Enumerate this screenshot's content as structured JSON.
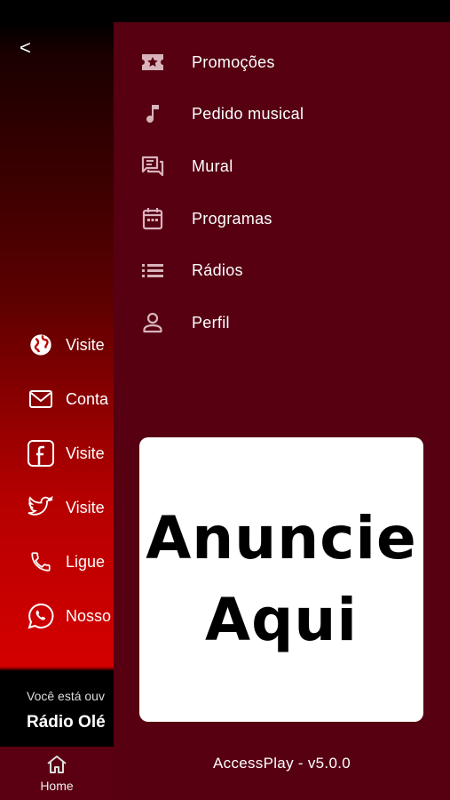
{
  "background": {
    "back_label": "<",
    "items": [
      {
        "icon": "globe-icon",
        "label": "Visite"
      },
      {
        "icon": "mail-icon",
        "label": "Conta"
      },
      {
        "icon": "facebook-icon",
        "label": "Visite"
      },
      {
        "icon": "twitter-icon",
        "label": "Visite"
      },
      {
        "icon": "phone-icon",
        "label": "Ligue"
      },
      {
        "icon": "whatsapp-icon",
        "label": "Nosso"
      }
    ],
    "now_playing": {
      "caption": "Você está ouv",
      "station": "Rádio Olé"
    },
    "tab_home": "Home"
  },
  "drawer": {
    "menu": [
      {
        "icon": "ticket-star-icon",
        "label": "Promoções"
      },
      {
        "icon": "music-note-icon",
        "label": "Pedido musical"
      },
      {
        "icon": "forum-icon",
        "label": "Mural"
      },
      {
        "icon": "calendar-icon",
        "label": "Programas"
      },
      {
        "icon": "list-icon",
        "label": "Rádios"
      },
      {
        "icon": "person-icon",
        "label": "Perfil"
      }
    ],
    "ad": {
      "line1": "Anuncie",
      "line2": "Aqui"
    },
    "version": "AccessPlay - v5.0.0"
  },
  "colors": {
    "drawer_bg": "#560012",
    "icon_tint": "#d9b3bb",
    "bottom_bar": "#5a0012"
  }
}
